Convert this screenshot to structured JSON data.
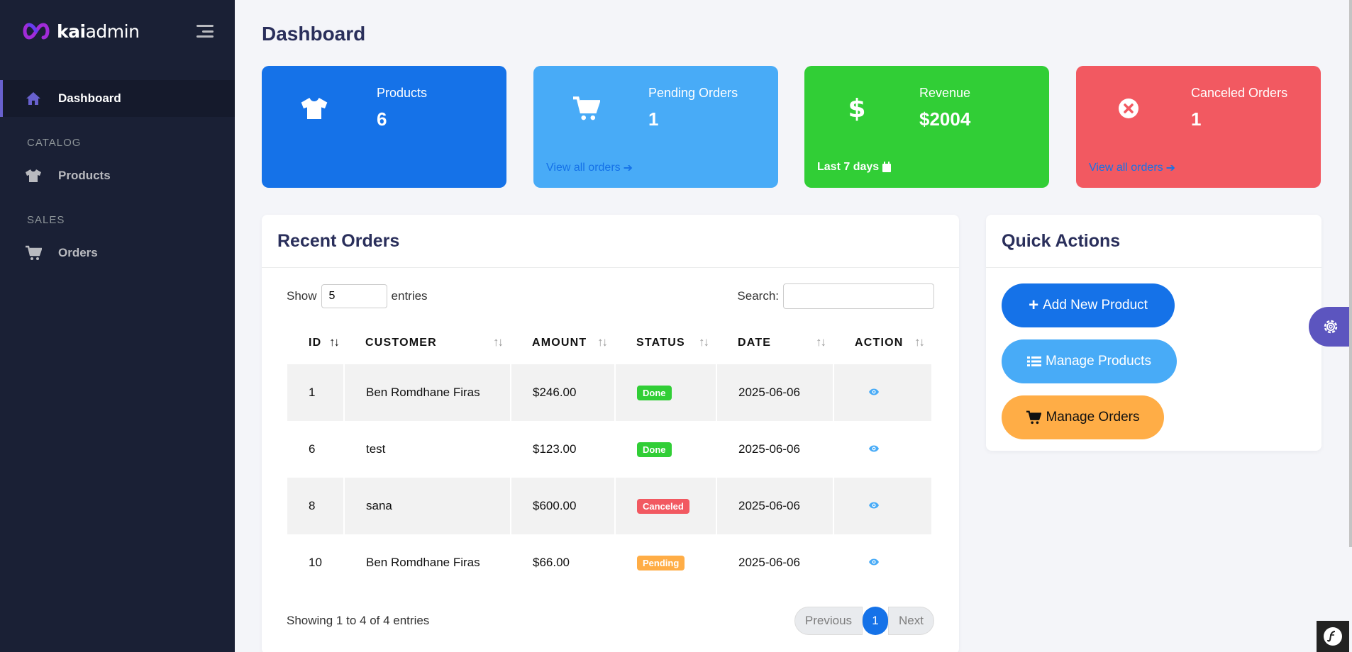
{
  "brand": {
    "prefix": "kai",
    "suffix": "admin"
  },
  "sidebar": {
    "items": [
      {
        "label": "Dashboard",
        "icon": "home-icon",
        "active": true
      },
      {
        "section": "CATALOG"
      },
      {
        "label": "Products",
        "icon": "shirt-icon"
      },
      {
        "section": "SALES"
      },
      {
        "label": "Orders",
        "icon": "cart-icon"
      }
    ]
  },
  "page": {
    "title": "Dashboard"
  },
  "stats": {
    "products": {
      "label": "Products",
      "value": "6"
    },
    "pending": {
      "label": "Pending Orders",
      "value": "1",
      "link": "View all orders"
    },
    "revenue": {
      "label": "Revenue",
      "value": "$2004",
      "footer": "Last 7 days"
    },
    "canceled": {
      "label": "Canceled Orders",
      "value": "1",
      "link": "View all orders"
    }
  },
  "orders": {
    "title": "Recent Orders",
    "show_label": "Show",
    "page_length": "5",
    "entries_label": "entries",
    "search_label": "Search:",
    "columns": [
      "ID",
      "CUSTOMER",
      "AMOUNT",
      "STATUS",
      "DATE",
      "ACTION"
    ],
    "rows": [
      {
        "id": "1",
        "customer": "Ben Romdhane Firas",
        "amount": "$246.00",
        "status": "Done",
        "date": "2025-06-06"
      },
      {
        "id": "6",
        "customer": "test",
        "amount": "$123.00",
        "status": "Done",
        "date": "2025-06-06"
      },
      {
        "id": "8",
        "customer": "sana",
        "amount": "$600.00",
        "status": "Canceled",
        "date": "2025-06-06"
      },
      {
        "id": "10",
        "customer": "Ben Romdhane Firas",
        "amount": "$66.00",
        "status": "Pending",
        "date": "2025-06-06"
      }
    ],
    "info": "Showing 1 to 4 of 4 entries",
    "pager": {
      "prev": "Previous",
      "current": "1",
      "next": "Next"
    }
  },
  "quick_actions": {
    "title": "Quick Actions",
    "add_product": "Add New Product",
    "manage_products": "Manage Products",
    "manage_orders": "Manage Orders"
  },
  "colors": {
    "sidebar_bg": "#1a2035",
    "primary": "#1572e8",
    "info": "#48abf7",
    "success": "#31ce36",
    "danger": "#f25961",
    "warning": "#ffad46",
    "accent": "#6861ce"
  }
}
